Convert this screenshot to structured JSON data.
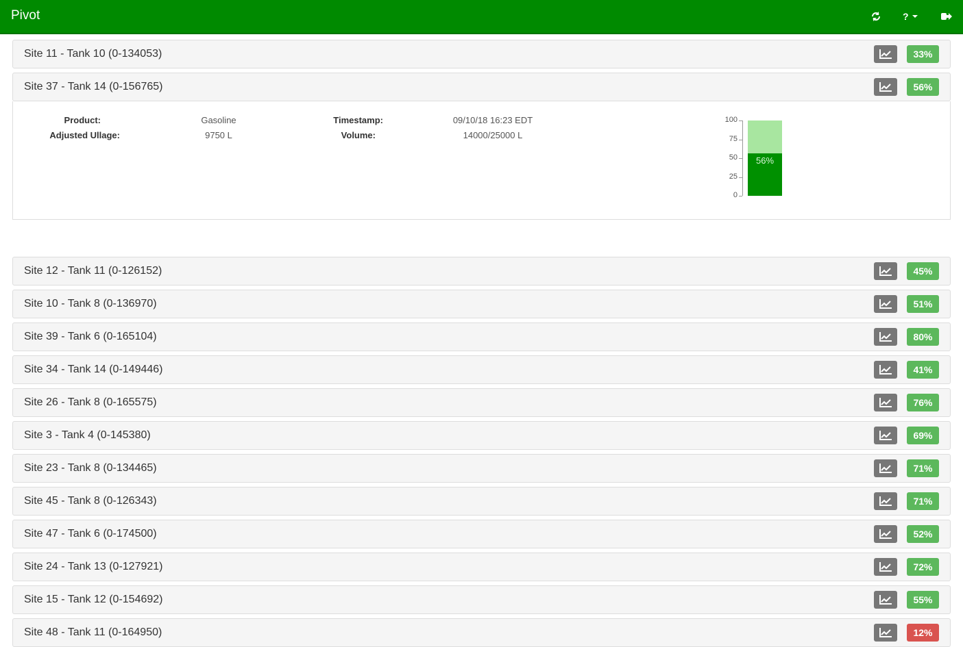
{
  "app": {
    "title": "Pivot"
  },
  "nav": {
    "refresh_icon": "refresh-icon",
    "help_label": "?",
    "logout_icon": "sign-out-icon"
  },
  "tanks": [
    {
      "label": "Site 11 - Tank 10 (0-134053)",
      "percent": "33%",
      "level": 0.33
    },
    {
      "label": "Site 37 - Tank 14 (0-156765)",
      "percent": "56%",
      "level": 0.56,
      "expanded": true
    },
    {
      "label": "Site 12 - Tank 11 (0-126152)",
      "percent": "45%",
      "level": 0.45
    },
    {
      "label": "Site 10 - Tank 8 (0-136970)",
      "percent": "51%",
      "level": 0.51
    },
    {
      "label": "Site 39 - Tank 6 (0-165104)",
      "percent": "80%",
      "level": 0.8
    },
    {
      "label": "Site 34 - Tank 14 (0-149446)",
      "percent": "41%",
      "level": 0.41
    },
    {
      "label": "Site 26 - Tank 8 (0-165575)",
      "percent": "76%",
      "level": 0.76
    },
    {
      "label": "Site 3 - Tank 4 (0-145380)",
      "percent": "69%",
      "level": 0.69
    },
    {
      "label": "Site 23 - Tank 8 (0-134465)",
      "percent": "71%",
      "level": 0.71
    },
    {
      "label": "Site 45 - Tank 8 (0-126343)",
      "percent": "71%",
      "level": 0.71
    },
    {
      "label": "Site 47 - Tank 6 (0-174500)",
      "percent": "52%",
      "level": 0.52
    },
    {
      "label": "Site 24 - Tank 13 (0-127921)",
      "percent": "72%",
      "level": 0.72
    },
    {
      "label": "Site 15 - Tank 12 (0-154692)",
      "percent": "55%",
      "level": 0.55
    },
    {
      "label": "Site 48 - Tank 11 (0-164950)",
      "percent": "12%",
      "level": 0.12,
      "status": "low"
    }
  ],
  "details": {
    "product_label": "Product:",
    "product_value": "Gasoline",
    "ullage_label": "Adjusted Ullage:",
    "ullage_value": "9750 L",
    "timestamp_label": "Timestamp:",
    "timestamp_value": "09/10/18 16:23 EDT",
    "volume_label": "Volume:",
    "volume_value": "14000/25000 L"
  },
  "chart_data": {
    "type": "bar",
    "categories": [
      ""
    ],
    "values": [
      56
    ],
    "bar_label": "56%",
    "ylim": [
      0,
      100
    ],
    "yticks": [
      "100",
      "75",
      "50",
      "25",
      "0"
    ],
    "colors": {
      "fill": "#009000",
      "empty": "#a8e6a0"
    }
  },
  "colors": {
    "header": "#008a00",
    "badge_ok": "#5cb85c",
    "badge_low": "#d9534f",
    "chart_button": "#777777"
  }
}
